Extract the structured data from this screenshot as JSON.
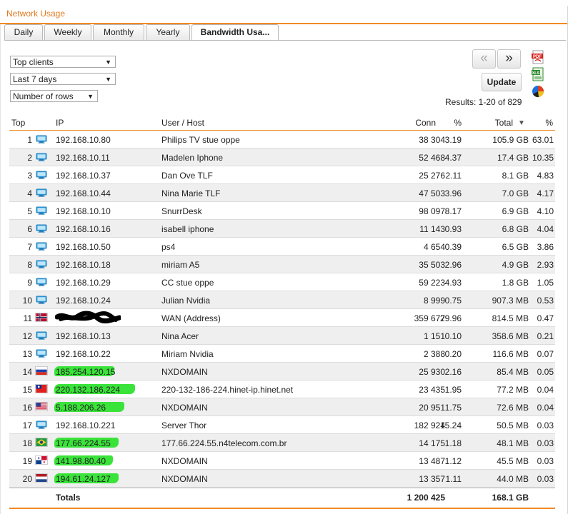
{
  "panel": {
    "title": "Network Usage"
  },
  "tabs": [
    {
      "label": "Daily"
    },
    {
      "label": "Weekly"
    },
    {
      "label": "Monthly"
    },
    {
      "label": "Yearly"
    },
    {
      "label": "Bandwidth Usa..."
    }
  ],
  "filters": {
    "view": "Top clients",
    "period": "Last 7 days",
    "rows": "Number of rows"
  },
  "pager": {
    "prev": "«",
    "next": "»",
    "update": "Update",
    "results": "Results: 1-20 of 829"
  },
  "exports": [
    {
      "icon": "pdf-icon",
      "color": "#d9221c"
    },
    {
      "icon": "xls-icon",
      "color": "#2f8a2f"
    },
    {
      "icon": "pie-chart-icon",
      "color": "#e0401c"
    }
  ],
  "table": {
    "headers": {
      "top": "Top",
      "ip": "IP",
      "user": "User / Host",
      "conn": "Conn",
      "pct": "%",
      "total": "Total",
      "sort": "▼",
      "pct2": "%"
    },
    "rows": [
      {
        "top": "1",
        "icon": "computer-icon",
        "ip": "192.168.10.80",
        "user": "Philips TV stue oppe",
        "conn": "38 304",
        "pct": "3.19",
        "total": "105.9 GB",
        "pct2": "63.01"
      },
      {
        "top": "2",
        "icon": "computer-icon",
        "ip": "192.168.10.11",
        "user": "Madelen Iphone",
        "conn": "52 468",
        "pct": "4.37",
        "total": "17.4 GB",
        "pct2": "10.35"
      },
      {
        "top": "3",
        "icon": "computer-icon",
        "ip": "192.168.10.37",
        "user": "Dan Ove TLF",
        "conn": "25 276",
        "pct": "2.11",
        "total": "8.1 GB",
        "pct2": "4.83"
      },
      {
        "top": "4",
        "icon": "computer-icon",
        "ip": "192.168.10.44",
        "user": "Nina Marie TLF",
        "conn": "47 503",
        "pct": "3.96",
        "total": "7.0 GB",
        "pct2": "4.17"
      },
      {
        "top": "5",
        "icon": "computer-icon",
        "ip": "192.168.10.10",
        "user": "SnurrDesk",
        "conn": "98 097",
        "pct": "8.17",
        "total": "6.9 GB",
        "pct2": "4.10"
      },
      {
        "top": "6",
        "icon": "computer-icon",
        "ip": "192.168.10.16",
        "user": "isabell iphone",
        "conn": "11 143",
        "pct": "0.93",
        "total": "6.8 GB",
        "pct2": "4.04"
      },
      {
        "top": "7",
        "icon": "computer-icon",
        "ip": "192.168.10.50",
        "user": "ps4",
        "conn": "4 654",
        "pct": "0.39",
        "total": "6.5 GB",
        "pct2": "3.86"
      },
      {
        "top": "8",
        "icon": "computer-icon",
        "ip": "192.168.10.18",
        "user": "miriam A5",
        "conn": "35 503",
        "pct": "2.96",
        "total": "4.9 GB",
        "pct2": "2.93"
      },
      {
        "top": "9",
        "icon": "computer-icon",
        "ip": "192.168.10.29",
        "user": "CC stue oppe",
        "conn": "59 223",
        "pct": "4.93",
        "total": "1.8 GB",
        "pct2": "1.05"
      },
      {
        "top": "10",
        "icon": "computer-icon",
        "ip": "192.168.10.24",
        "user": "Julian Nvidia",
        "conn": "8 999",
        "pct": "0.75",
        "total": "907.3 MB",
        "pct2": "0.53"
      },
      {
        "top": "11",
        "icon": "flag-norway-icon",
        "ip": "",
        "redacted": true,
        "user": "WAN (Address)",
        "conn": "359 677",
        "pct": "29.96",
        "total": "814.5 MB",
        "pct2": "0.47"
      },
      {
        "top": "12",
        "icon": "computer-icon",
        "ip": "192.168.10.13",
        "user": "Nina Acer",
        "conn": "1 151",
        "pct": "0.10",
        "total": "358.6 MB",
        "pct2": "0.21"
      },
      {
        "top": "13",
        "icon": "computer-icon",
        "ip": "192.168.10.22",
        "user": "Miriam Nvidia",
        "conn": "2 388",
        "pct": "0.20",
        "total": "116.6 MB",
        "pct2": "0.07"
      },
      {
        "top": "14",
        "icon": "flag-russia-icon",
        "ip": "185.254.120.15",
        "highlight": true,
        "user": "NXDOMAIN",
        "conn": "25 930",
        "pct": "2.16",
        "total": "85.4 MB",
        "pct2": "0.05"
      },
      {
        "top": "15",
        "icon": "flag-taiwan-icon",
        "ip": "220.132.186.224",
        "highlight": true,
        "user": "220-132-186-224.hinet-ip.hinet.net",
        "conn": "23 435",
        "pct": "1.95",
        "total": "77.2 MB",
        "pct2": "0.04"
      },
      {
        "top": "16",
        "icon": "flag-usa-icon",
        "ip": "5.188.206.26",
        "highlight": true,
        "user": "NXDOMAIN",
        "conn": "20 951",
        "pct": "1.75",
        "total": "72.6 MB",
        "pct2": "0.04"
      },
      {
        "top": "17",
        "icon": "computer-icon",
        "ip": "192.168.10.221",
        "user": "Server Thor",
        "conn": "182 924",
        "pct": "15.24",
        "total": "50.5 MB",
        "pct2": "0.03"
      },
      {
        "top": "18",
        "icon": "flag-brazil-icon",
        "ip": "177.66.224.55",
        "highlight": true,
        "user": "177.66.224.55.n4telecom.com.br",
        "conn": "14 175",
        "pct": "1.18",
        "total": "48.1 MB",
        "pct2": "0.03"
      },
      {
        "top": "19",
        "icon": "flag-panama-icon",
        "ip": "141.98.80.40",
        "highlight": true,
        "user": "NXDOMAIN",
        "conn": "13 487",
        "pct": "1.12",
        "total": "45.5 MB",
        "pct2": "0.03"
      },
      {
        "top": "20",
        "icon": "flag-netherlands-icon",
        "ip": "194.61.24.127",
        "highlight": true,
        "user": "NXDOMAIN",
        "conn": "13 357",
        "pct": "1.11",
        "total": "44.0 MB",
        "pct2": "0.03"
      }
    ],
    "totals": {
      "label": "Totals",
      "conn": "1 200 425",
      "total": "168.1 GB"
    }
  },
  "colors": {
    "accent": "#f08a24",
    "highlight": "#2fe12f",
    "row_alt": "#efefef"
  }
}
